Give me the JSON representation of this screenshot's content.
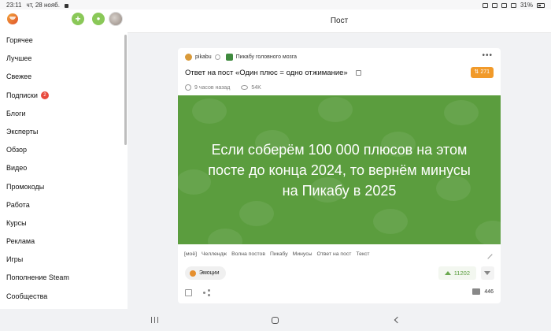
{
  "statusbar": {
    "time": "23:11",
    "date": "чт, 28 нояб.",
    "battery": "31%"
  },
  "sidebar": {
    "items": [
      {
        "label": "Горячее"
      },
      {
        "label": "Лучшее"
      },
      {
        "label": "Свежее"
      },
      {
        "label": "Подписки",
        "badge": "2"
      },
      {
        "label": "Блоги"
      },
      {
        "label": "Эксперты"
      },
      {
        "label": "Обзор"
      },
      {
        "label": "Видео"
      },
      {
        "label": "Промокоды"
      },
      {
        "label": "Работа"
      },
      {
        "label": "Курсы"
      },
      {
        "label": "Реклама"
      },
      {
        "label": "Игры"
      },
      {
        "label": "Пополнение Steam"
      },
      {
        "label": "Сообщества"
      }
    ]
  },
  "topbar": {
    "title": "Пост"
  },
  "post": {
    "author": "pikabu",
    "community": "Пикабу головного мозга",
    "title": "Ответ на пост «Один плюс = одно отжимание»",
    "rating": "271",
    "time_ago": "9 часов назад",
    "views": "54K",
    "banner_lines": [
      "Если соберём 100 000 плюсов на этом",
      "посте до конца 2024, то вернём минусы",
      "на Пикабу в 2025"
    ],
    "tags": [
      "[моё]",
      "Челлендж",
      "Волна постов",
      "Пикабу",
      "Минусы",
      "Ответ на пост",
      "Текст"
    ],
    "emotions_label": "Эмоции",
    "upvotes": "11202",
    "comments": "446",
    "banner_color": "#5b9d3e",
    "accent_color": "#f19a2a"
  }
}
